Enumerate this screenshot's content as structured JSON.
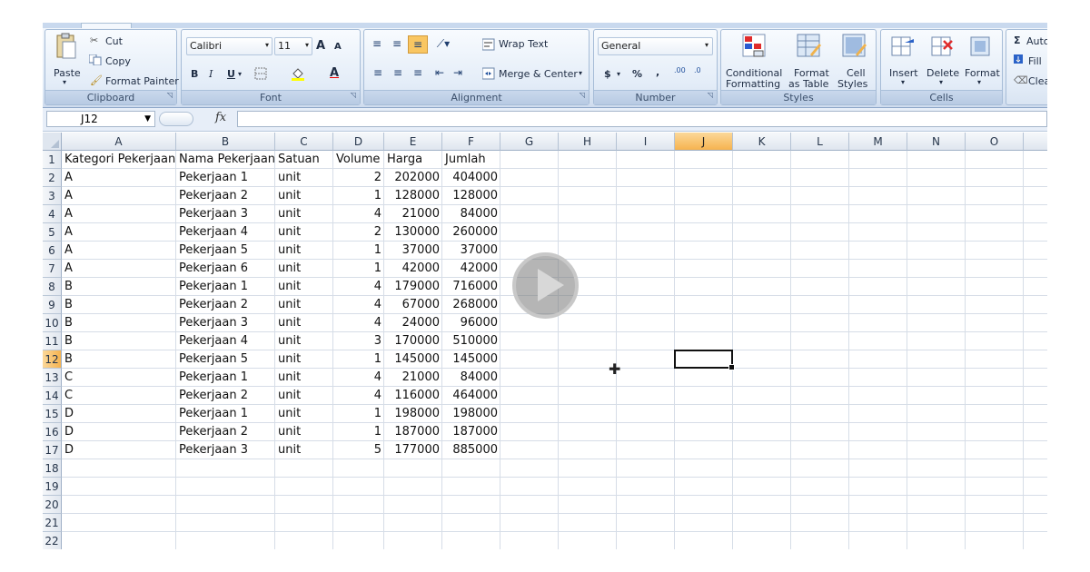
{
  "ribbon": {
    "clipboard": {
      "label": "Clipboard",
      "paste": "Paste",
      "cut": "Cut",
      "copy": "Copy",
      "format_painter": "Format Painter"
    },
    "font": {
      "label": "Font",
      "font_name": "Calibri",
      "font_size": "11",
      "bold": "B",
      "italic": "I",
      "underline": "U",
      "grow": "A",
      "shrink": "A",
      "font_color": "A"
    },
    "alignment": {
      "label": "Alignment",
      "wrap_text": "Wrap Text",
      "merge_center": "Merge & Center"
    },
    "number": {
      "label": "Number",
      "format": "General",
      "currency": "$",
      "percent": "%",
      "comma": ",",
      "inc_decimal": ".00",
      "dec_decimal": ".0"
    },
    "styles": {
      "label": "Styles",
      "conditional_formatting": [
        "Conditional",
        "Formatting"
      ],
      "format_as_table": [
        "Format",
        "as Table"
      ],
      "cell_styles": [
        "Cell",
        "Styles"
      ]
    },
    "cells": {
      "label": "Cells",
      "insert": "Insert",
      "delete": "Delete",
      "format": "Format"
    },
    "editing": {
      "sigma": "Σ",
      "autosum": "Auto",
      "fill": "Fill",
      "clear": "Clea"
    }
  },
  "formula_bar": {
    "name_box": "J12",
    "fx": "fx",
    "formula": ""
  },
  "columns": [
    {
      "id": "A",
      "w": 126
    },
    {
      "id": "B",
      "w": 109
    },
    {
      "id": "C",
      "w": 64
    },
    {
      "id": "D",
      "w": 56
    },
    {
      "id": "E",
      "w": 64
    },
    {
      "id": "F",
      "w": 64
    },
    {
      "id": "G",
      "w": 64
    },
    {
      "id": "H",
      "w": 64
    },
    {
      "id": "I",
      "w": 64
    },
    {
      "id": "J",
      "w": 64
    },
    {
      "id": "K",
      "w": 64
    },
    {
      "id": "L",
      "w": 64
    },
    {
      "id": "M",
      "w": 64
    },
    {
      "id": "N",
      "w": 64
    },
    {
      "id": "O",
      "w": 64
    },
    {
      "id": "",
      "w": 40
    }
  ],
  "rows": [
    "1",
    "2",
    "3",
    "4",
    "5",
    "6",
    "7",
    "8",
    "9",
    "10",
    "11",
    "12",
    "13",
    "14",
    "15",
    "16",
    "17",
    "18",
    "19",
    "20",
    "21",
    "22"
  ],
  "active_cell": {
    "col": "J",
    "row": "12"
  },
  "table": {
    "headers": [
      "Kategori Pekerjaan",
      "Nama Pekerjaan",
      "Satuan",
      "Volume",
      "Harga",
      "Jumlah"
    ],
    "data": [
      [
        "A",
        "Pekerjaan 1",
        "unit",
        "2",
        "202000",
        "404000"
      ],
      [
        "A",
        "Pekerjaan 2",
        "unit",
        "1",
        "128000",
        "128000"
      ],
      [
        "A",
        "Pekerjaan 3",
        "unit",
        "4",
        "21000",
        "84000"
      ],
      [
        "A",
        "Pekerjaan 4",
        "unit",
        "2",
        "130000",
        "260000"
      ],
      [
        "A",
        "Pekerjaan 5",
        "unit",
        "1",
        "37000",
        "37000"
      ],
      [
        "A",
        "Pekerjaan 6",
        "unit",
        "1",
        "42000",
        "42000"
      ],
      [
        "B",
        "Pekerjaan 1",
        "unit",
        "4",
        "179000",
        "716000"
      ],
      [
        "B",
        "Pekerjaan 2",
        "unit",
        "4",
        "67000",
        "268000"
      ],
      [
        "B",
        "Pekerjaan 3",
        "unit",
        "4",
        "24000",
        "96000"
      ],
      [
        "B",
        "Pekerjaan 4",
        "unit",
        "3",
        "170000",
        "510000"
      ],
      [
        "B",
        "Pekerjaan 5",
        "unit",
        "1",
        "145000",
        "145000"
      ],
      [
        "C",
        "Pekerjaan 1",
        "unit",
        "4",
        "21000",
        "84000"
      ],
      [
        "C",
        "Pekerjaan 2",
        "unit",
        "4",
        "116000",
        "464000"
      ],
      [
        "D",
        "Pekerjaan 1",
        "unit",
        "1",
        "198000",
        "198000"
      ],
      [
        "D",
        "Pekerjaan 2",
        "unit",
        "1",
        "187000",
        "187000"
      ],
      [
        "D",
        "Pekerjaan 3",
        "unit",
        "5",
        "177000",
        "885000"
      ]
    ]
  },
  "colors": {
    "active_header": "#f6b34f",
    "gridline": "#d6dde7",
    "ribbon": "#dde8f5"
  }
}
